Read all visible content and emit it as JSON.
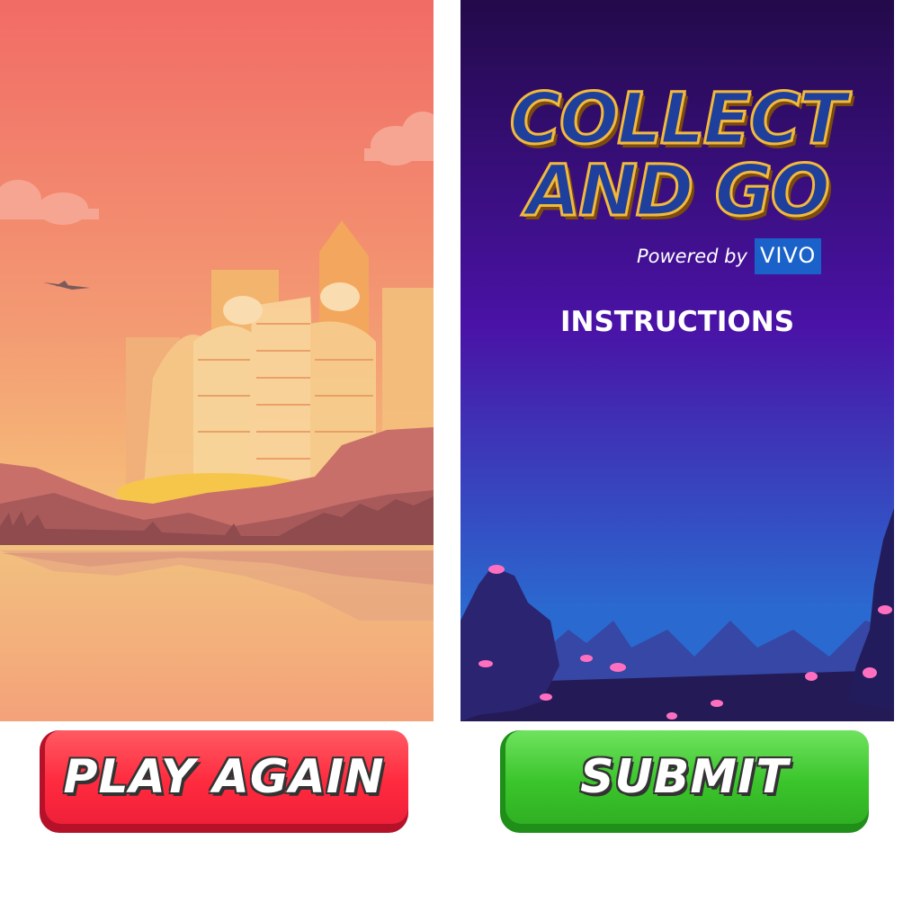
{
  "game": {
    "title_line_1": "COLLECT",
    "title_line_2": "AND GO",
    "powered_by": "Powered by",
    "brand": "VIVO",
    "instructions_heading": "INSTRUCTIONS"
  },
  "buttons": {
    "play_again": "PLAY AGAIN",
    "submit": "SUBMIT"
  },
  "colors": {
    "sky_top": "#f26b66",
    "sky_bottom": "#f7c47a",
    "night_top": "#230a4a",
    "night_bottom": "#2a6ad0",
    "play_again": "#ff2a3e",
    "submit": "#3bc52c"
  }
}
